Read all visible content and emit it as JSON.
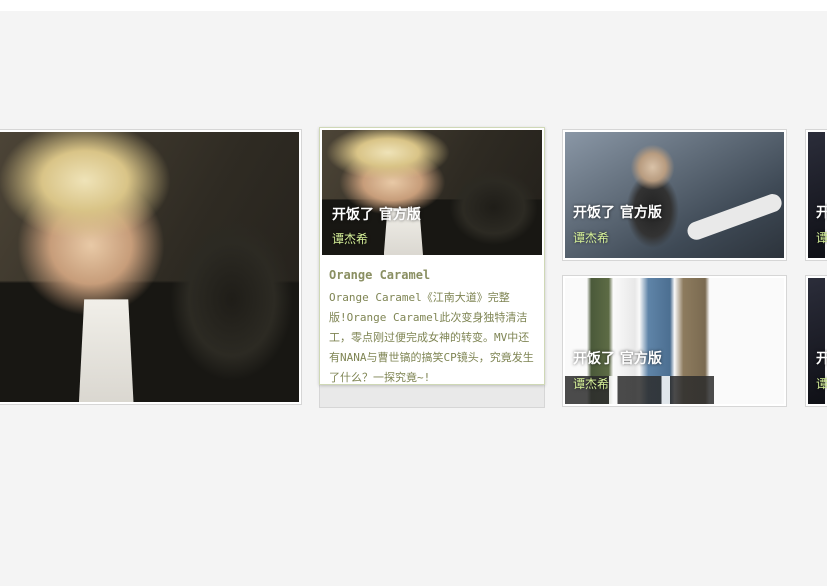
{
  "colors": {
    "caption_title": "#ffffff",
    "caption_artist": "#d8f39a",
    "desc_text": "#7f8554",
    "page_bg": "#f4f4f4"
  },
  "featured": {
    "image": "artist-portrait-large"
  },
  "hover_card": {
    "title": "开饭了 官方版",
    "artist": "谭杰希",
    "desc_title": "Orange Caramel",
    "desc_body": "Orange Caramel《江南大道》完整版!Orange Caramel此次变身独特清洁工，零点刚过便完成女神的转变。MV中还有NANA与曹世镐的搞笑CP镜头，究竟发生了什么？一探究竟~!"
  },
  "cards": [
    {
      "title": "开饭了 官方版",
      "artist": "谭杰希",
      "image": "guitar-stage"
    },
    {
      "title": "开饭了 官方版",
      "artist": "谭杰希",
      "image": "band-group"
    },
    {
      "title": "开",
      "artist": "谭",
      "image": "partial-dark"
    },
    {
      "title": "开",
      "artist": "谭",
      "image": "partial-dark"
    }
  ]
}
